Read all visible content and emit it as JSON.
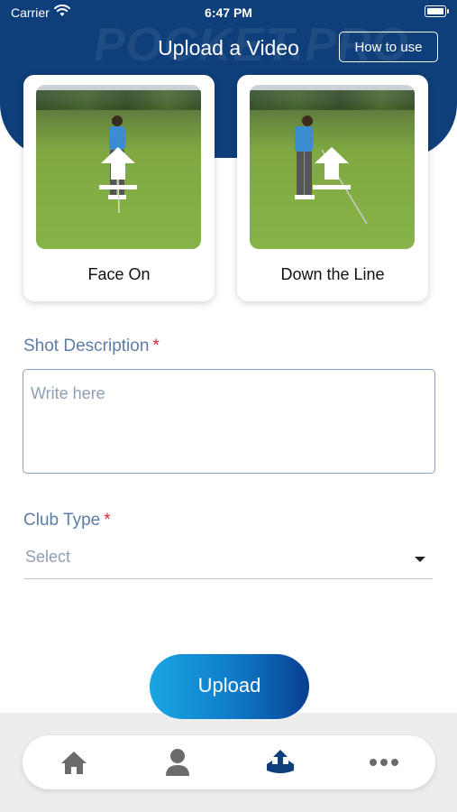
{
  "status_bar": {
    "carrier": "Carrier",
    "time": "6:47 PM"
  },
  "header": {
    "watermark": "POCKET.PRO",
    "title": "Upload a Video",
    "how_to_label": "How to use"
  },
  "video_cards": [
    {
      "label": "Face On"
    },
    {
      "label": "Down the Line"
    }
  ],
  "form": {
    "shot_description_label": "Shot Description",
    "required_mark": "*",
    "shot_description_placeholder": "Write here",
    "club_type_label": "Club Type",
    "club_type_value": "Select"
  },
  "upload_button_label": "Upload",
  "colors": {
    "header_bg": "#0f3f7a",
    "label_color": "#5c7da6",
    "required_color": "#d8262d",
    "nav_active": "#0f3f7a",
    "nav_inactive": "#6b6b6b"
  },
  "bottom_nav": [
    {
      "icon": "home-icon",
      "active": false
    },
    {
      "icon": "profile-icon",
      "active": false
    },
    {
      "icon": "upload-icon",
      "active": true
    },
    {
      "icon": "more-icon",
      "active": false
    }
  ]
}
